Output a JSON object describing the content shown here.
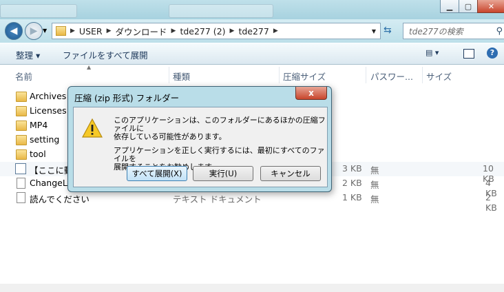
{
  "address": {
    "crumbs": [
      "USER",
      "ダウンロード",
      "tde277 (2)",
      "tde277"
    ],
    "search_placeholder": "tde277の検索"
  },
  "toolbar": {
    "organize": "整理 ▾",
    "extract_all": "ファイルをすべて展開"
  },
  "columns": {
    "name": "名前",
    "type": "種類",
    "compressed_size": "圧縮サイズ",
    "password": "パスワー...",
    "size": "サイズ"
  },
  "files": [
    {
      "name": "Archives"
    },
    {
      "name": "Licenses"
    },
    {
      "name": "MP4"
    },
    {
      "name": "setting"
    },
    {
      "name": "tool"
    },
    {
      "name": "【ここに動",
      "csize": "3 KB",
      "pw": "無",
      "size": "10 KB"
    },
    {
      "name": "ChangeLo",
      "csize": "2 KB",
      "pw": "無",
      "size": "4 KB"
    },
    {
      "name": "読んでください",
      "type": "テキスト ドキュメント",
      "csize": "1 KB",
      "pw": "無",
      "size": "2 KB"
    }
  ],
  "dialog": {
    "title": "圧縮 (zip 形式) フォルダー",
    "message_line1": "このアプリケーションは、このフォルダーにあるほかの圧縮ファイルに",
    "message_line2": "依存している可能性があります。",
    "message_line3": "アプリケーションを正しく実行するには、最初にすべてのファイルを",
    "message_line4": "展開することをお勧めします。",
    "extract_all_btn": "すべて展開(X)",
    "run_btn": "実行(U)",
    "cancel_btn": "キャンセル",
    "close_glyph": "x"
  }
}
